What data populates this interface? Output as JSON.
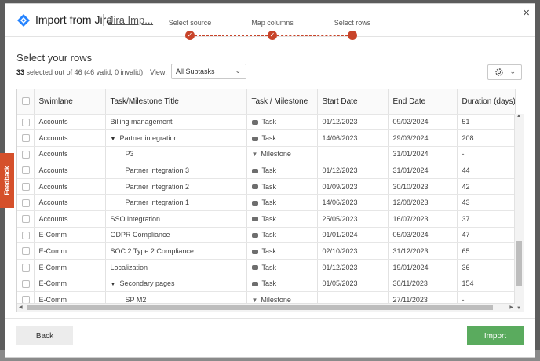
{
  "header": {
    "title": "Import from Jira",
    "subtitle": "Jira Imp...",
    "close_symbol": "×"
  },
  "steps": [
    {
      "label": "Select source",
      "done": true
    },
    {
      "label": "Map columns",
      "done": true
    },
    {
      "label": "Select rows",
      "done": false
    }
  ],
  "main": {
    "section_title": "Select your rows",
    "count_bold": "33",
    "count_rest": "selected out of 46 (46 valid, 0 invalid)",
    "view_label": "View:",
    "view_value": "All Subtasks"
  },
  "table": {
    "columns": [
      "Swimlane",
      "Task/Milestone Title",
      "Task / Milestone",
      "Start Date",
      "End Date",
      "Duration (days)"
    ],
    "rows": [
      {
        "swimlane": "Accounts",
        "title": "Billing management",
        "type": "Task",
        "start": "01/12/2023",
        "end": "09/02/2024",
        "duration": "51",
        "indent": false,
        "caret": false
      },
      {
        "swimlane": "Accounts",
        "title": "Partner integration",
        "type": "Task",
        "start": "14/06/2023",
        "end": "29/03/2024",
        "duration": "208",
        "indent": false,
        "caret": true
      },
      {
        "swimlane": "Accounts",
        "title": "P3",
        "type": "Milestone",
        "start": "",
        "end": "31/01/2024",
        "duration": "-",
        "indent": true,
        "caret": false
      },
      {
        "swimlane": "Accounts",
        "title": "Partner integration 3",
        "type": "Task",
        "start": "01/12/2023",
        "end": "31/01/2024",
        "duration": "44",
        "indent": true,
        "caret": false
      },
      {
        "swimlane": "Accounts",
        "title": "Partner integration 2",
        "type": "Task",
        "start": "01/09/2023",
        "end": "30/10/2023",
        "duration": "42",
        "indent": true,
        "caret": false
      },
      {
        "swimlane": "Accounts",
        "title": "Partner integration 1",
        "type": "Task",
        "start": "14/06/2023",
        "end": "12/08/2023",
        "duration": "43",
        "indent": true,
        "caret": false
      },
      {
        "swimlane": "Accounts",
        "title": "SSO integration",
        "type": "Task",
        "start": "25/05/2023",
        "end": "16/07/2023",
        "duration": "37",
        "indent": false,
        "caret": false
      },
      {
        "swimlane": "E-Comm",
        "title": "GDPR Compliance",
        "type": "Task",
        "start": "01/01/2024",
        "end": "05/03/2024",
        "duration": "47",
        "indent": false,
        "caret": false
      },
      {
        "swimlane": "E-Comm",
        "title": "SOC 2 Type 2 Compliance",
        "type": "Task",
        "start": "02/10/2023",
        "end": "31/12/2023",
        "duration": "65",
        "indent": false,
        "caret": false
      },
      {
        "swimlane": "E-Comm",
        "title": "Localization",
        "type": "Task",
        "start": "01/12/2023",
        "end": "19/01/2024",
        "duration": "36",
        "indent": false,
        "caret": false
      },
      {
        "swimlane": "E-Comm",
        "title": "Secondary pages",
        "type": "Task",
        "start": "01/05/2023",
        "end": "30/11/2023",
        "duration": "154",
        "indent": false,
        "caret": true
      },
      {
        "swimlane": "E-Comm",
        "title": "SP M2",
        "type": "Milestone",
        "start": "",
        "end": "27/11/2023",
        "duration": "-",
        "indent": true,
        "caret": false
      }
    ]
  },
  "footer": {
    "back_label": "Back",
    "import_label": "Import"
  },
  "feedback": {
    "label": "Feedback"
  },
  "colors": {
    "accent": "#c8442a",
    "import": "#5aab5e",
    "feedback": "#d5502b"
  }
}
